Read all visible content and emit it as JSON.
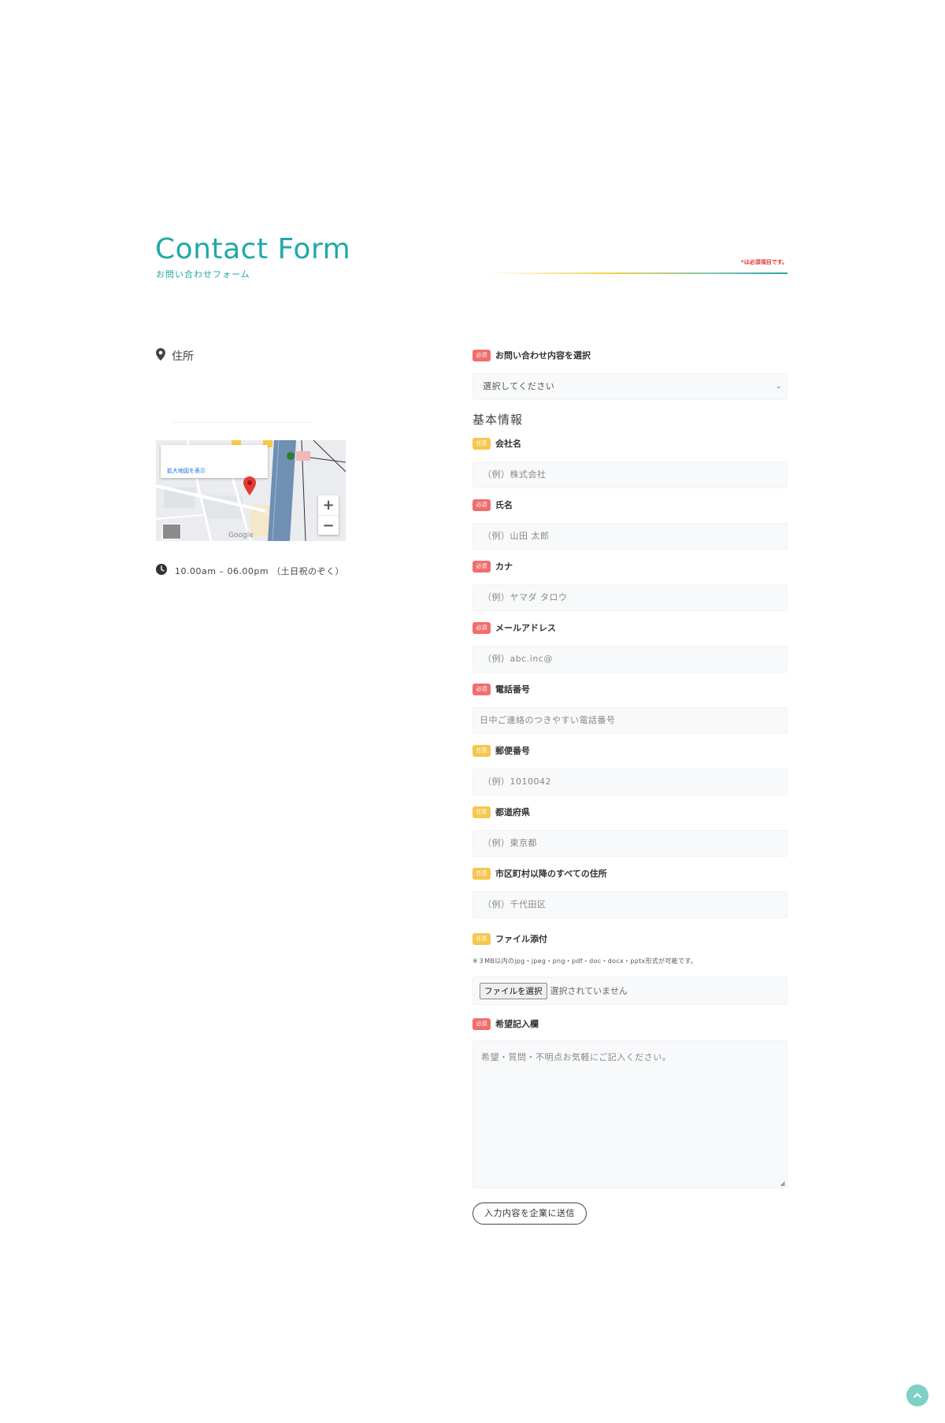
{
  "header": {
    "title": "Contact Form",
    "subtitle": "お問い合わせフォーム",
    "required_note": "*は必須項目です。"
  },
  "left": {
    "address_label": "住所",
    "map": {
      "link_label": "拡大地図を表示",
      "zoom_in": "+",
      "zoom_out": "−",
      "attribution": "Google"
    },
    "hours": "10.00am – 06.00pm （土日祝のぞく）"
  },
  "badges": {
    "required": "必須",
    "optional": "任意"
  },
  "form": {
    "inquiry_type": {
      "label": "お問い合わせ内容を選択",
      "required": true,
      "selected": "選択してください"
    },
    "section_basic": "基本情報",
    "company": {
      "label": "会社名",
      "required": false,
      "placeholder": "（例）株式会社"
    },
    "name": {
      "label": "氏名",
      "required": true,
      "placeholder": "（例）山田 太郎"
    },
    "kana": {
      "label": "カナ",
      "required": true,
      "placeholder": "（例）ヤマダ タロウ"
    },
    "email": {
      "label": "メールアドレス",
      "required": true,
      "placeholder": "（例）abc.inc@"
    },
    "phone": {
      "label": "電話番号",
      "required": true,
      "placeholder": "日中ご連絡のつきやすい電話番号"
    },
    "zip": {
      "label": "郵便番号",
      "required": false,
      "placeholder": "（例）1010042"
    },
    "prefecture": {
      "label": "都道府県",
      "required": false,
      "placeholder": "（例）東京都"
    },
    "address": {
      "label": "市区町村以降のすべての住所",
      "required": false,
      "placeholder": "（例）千代田区"
    },
    "attachment": {
      "label": "ファイル添付",
      "required": false,
      "note": "※３MB以内のjpg・jpeg・png・pdf・doc・docx・pptx形式が可能です。",
      "button": "ファイルを選択",
      "status": "選択されていません"
    },
    "message": {
      "label": "希望記入欄",
      "required": true,
      "placeholder": "希望・質問・不明点お気軽にご記入ください。"
    },
    "submit_label": "入力内容を企業に送信"
  },
  "colors": {
    "accent": "#1fa9a7",
    "required_badge": "#f26d6d",
    "optional_badge": "#f6c64d",
    "scroll_top": "#7fd0c6"
  },
  "icons": {
    "address": "location-pin-icon",
    "hours": "clock-icon",
    "scroll_top": "chevron-up-icon"
  }
}
